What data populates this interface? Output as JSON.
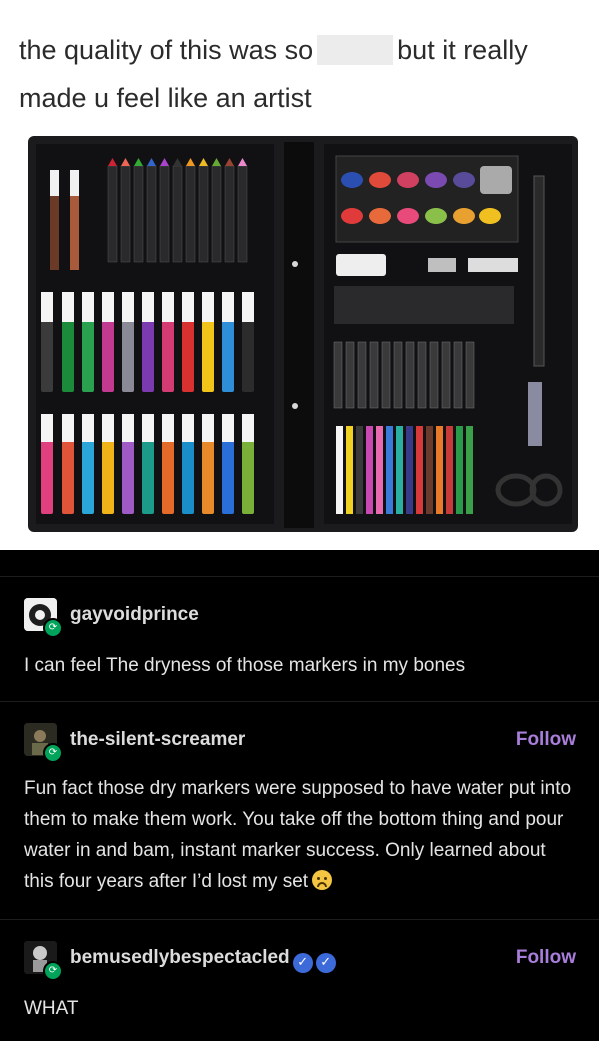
{
  "caption": {
    "part1": "the quality of this was so",
    "part2": "but it really made u feel like an artist"
  },
  "image": {
    "alt_labels": [
      "CRAYON",
      "ERASER"
    ]
  },
  "posts": [
    {
      "username": "gayvoidprince",
      "text": "I can feel The dryness of those markers in my bones",
      "follow": ""
    },
    {
      "username": "the-silent-screamer",
      "text": "Fun fact those dry markers were supposed to have water put into them to make them work. You take off the bottom thing and pour water in and bam, instant marker success. Only learned about this four years after I’d lost my set",
      "follow": "Follow"
    },
    {
      "username": "bemusedlybespectacled",
      "text": "WHAT",
      "follow": "Follow"
    }
  ],
  "colors": {
    "background": "#000000",
    "follow": "#a97eda",
    "reblog_badge": "#00a35a",
    "verified": "#3d6ad9"
  },
  "icons": {
    "reblog": "reblog-icon",
    "verified": "verified-check-icon",
    "emoji": "upside-down-face-emoji"
  }
}
